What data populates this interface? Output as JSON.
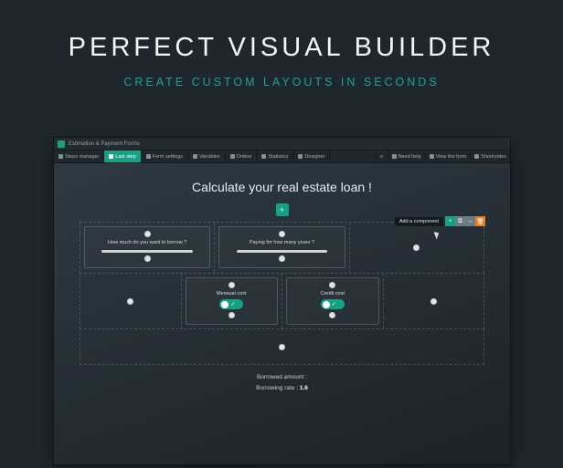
{
  "hero": {
    "title": "PERFECT VISUAL BUILDER",
    "subtitle": "CREATE CUSTOM LAYOUTS IN SECONDS"
  },
  "app": {
    "window_title": "Estimation & Payment Forms",
    "tabs": {
      "steps_manager": "Steps manager",
      "last_step": "Last step",
      "form_settings": "Form settings",
      "variables": "Variables",
      "orders": "Orders",
      "statistics": "Statistics",
      "designer": "Designer"
    },
    "right_actions": {
      "icon1": "∞",
      "need_help": "Need help",
      "view_form": "View the form",
      "shortcodes": "Shortcodes"
    },
    "canvas_title": "Calculate your real estate loan !",
    "add_btn": "+",
    "tooltip": "Add a component",
    "cards": {
      "borrow_label": "How much do you want to borrow ?",
      "years_label": "Paying for how many years ?",
      "mensual_label": "Mensual cost",
      "credit_label": "Credit cost"
    },
    "toggle_check": "✓",
    "bottom": {
      "borrowed_label": "Borrowed amount :",
      "rate_label": "Borrowing rate :",
      "rate_value": "1.6"
    },
    "icons": {
      "dup": "⧉",
      "mov": "↔",
      "del": "🗑"
    }
  }
}
